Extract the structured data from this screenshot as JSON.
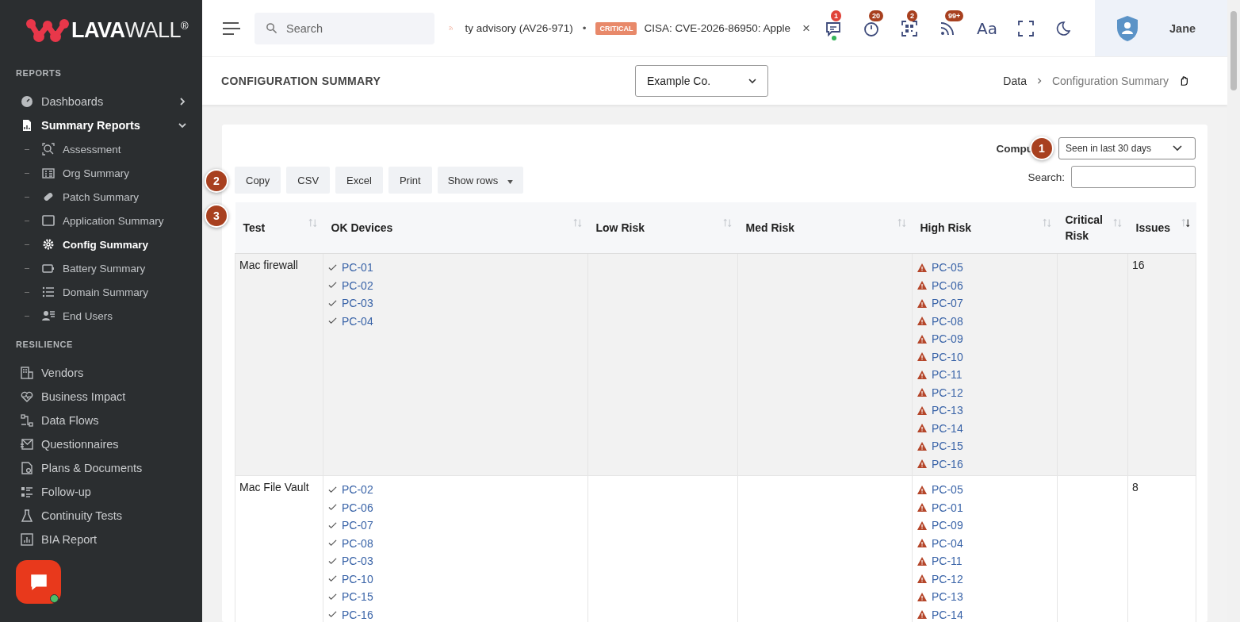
{
  "brand": {
    "name_bold": "LAVA",
    "name_light": "WALL",
    "mark": "®"
  },
  "sidebar": {
    "sections": [
      {
        "title": "REPORTS",
        "items": [
          {
            "label": "Dashboards",
            "selected": false,
            "expanded": false
          },
          {
            "label": "Summary Reports",
            "selected": true,
            "expanded": true,
            "children": [
              {
                "label": "Assessment",
                "selected": false
              },
              {
                "label": "Org Summary",
                "selected": false
              },
              {
                "label": "Patch Summary",
                "selected": false
              },
              {
                "label": "Application Summary",
                "selected": false
              },
              {
                "label": "Config Summary",
                "selected": true
              },
              {
                "label": "Battery Summary",
                "selected": false
              },
              {
                "label": "Domain Summary",
                "selected": false
              },
              {
                "label": "End Users",
                "selected": false
              }
            ]
          }
        ]
      },
      {
        "title": "RESILIENCE",
        "items": [
          {
            "label": "Vendors",
            "selected": false
          },
          {
            "label": "Business Impact",
            "selected": false
          },
          {
            "label": "Data Flows",
            "selected": false
          },
          {
            "label": "Questionnaires",
            "selected": false
          },
          {
            "label": "Plans & Documents",
            "selected": false
          },
          {
            "label": "Follow-up",
            "selected": false
          },
          {
            "label": "Continuity Tests",
            "selected": false
          },
          {
            "label": "BIA Report",
            "selected": false
          }
        ]
      }
    ]
  },
  "topbar": {
    "search": {
      "placeholder": "Search"
    },
    "ticker": {
      "text": "ty advisory (AV26-971)",
      "separator": "•",
      "badge": "CRITICAL",
      "headline": "CISA: CVE-2026-86950: Apple",
      "close": "×"
    },
    "notifications": [
      {
        "count": "1",
        "online": true
      },
      {
        "count": "20",
        "online": false
      },
      {
        "count": "2",
        "online": false
      },
      {
        "count": "99+",
        "online": false
      }
    ],
    "font_button": "Aa",
    "user": {
      "name": "Jane"
    }
  },
  "page": {
    "title": "CONFIGURATION SUMMARY",
    "company": "Example Co.",
    "breadcrumb": [
      "Data",
      "Configuration Summary"
    ]
  },
  "filter": {
    "label": "Compu",
    "marker": "1",
    "value": "Seen in last 30 days"
  },
  "toolbar": {
    "marker": "2",
    "buttons": [
      "Copy",
      "CSV",
      "Excel",
      "Print"
    ],
    "show_rows": "Show rows",
    "search_label": "Search:"
  },
  "table": {
    "marker": "3",
    "columns": [
      {
        "label": "Test",
        "sorted": false
      },
      {
        "label": "OK Devices",
        "sorted": false
      },
      {
        "label": "Low Risk",
        "sorted": false
      },
      {
        "label": "Med Risk",
        "sorted": false
      },
      {
        "label": "High Risk",
        "sorted": false
      },
      {
        "label": "Critical Risk",
        "sorted": false
      },
      {
        "label": "Issues",
        "sorted": true
      }
    ],
    "rows": [
      {
        "test": "Mac firewall",
        "ok": [
          "PC-01",
          "PC-02",
          "PC-03",
          "PC-04"
        ],
        "low": [],
        "med": [],
        "high": [
          "PC-05",
          "PC-06",
          "PC-07",
          "PC-08",
          "PC-09",
          "PC-10",
          "PC-11",
          "PC-12",
          "PC-13",
          "PC-14",
          "PC-15",
          "PC-16"
        ],
        "critical": [],
        "issues": "16"
      },
      {
        "test": "Mac File Vault",
        "ok": [
          "PC-02",
          "PC-06",
          "PC-07",
          "PC-08",
          "PC-03",
          "PC-10",
          "PC-15",
          "PC-16"
        ],
        "low": [],
        "med": [],
        "high": [
          "PC-05",
          "PC-01",
          "PC-09",
          "PC-04",
          "PC-11",
          "PC-12",
          "PC-13",
          "PC-14"
        ],
        "critical": [],
        "issues": "8"
      }
    ]
  }
}
